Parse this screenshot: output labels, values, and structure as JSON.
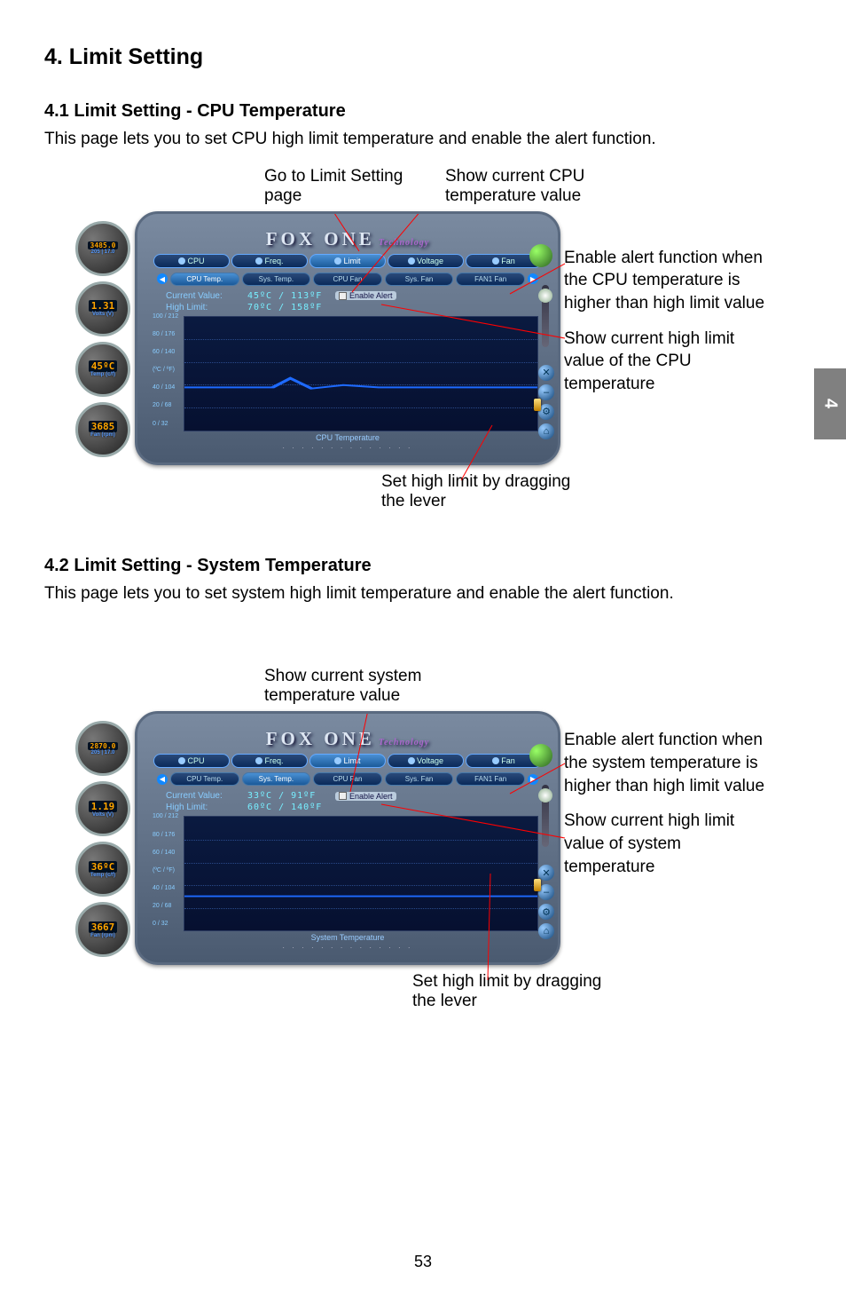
{
  "page_tab": "4",
  "page_number": "53",
  "heading": "4. Limit Setting",
  "section1": {
    "title": "4.1 Limit Setting - CPU Temperature",
    "desc": "This page lets you to set CPU high limit temperature and enable the alert function.",
    "callout_go_to_limit": "Go to Limit Setting page",
    "callout_show_current_cpu": "Show current CPU temperature value",
    "callout_enable_alert": "Enable alert function when the CPU temperature is higher than high limit value",
    "callout_show_high_limit": "Show current high limit value of the CPU temperature",
    "callout_set_high_limit": "Set high limit by dragging the lever",
    "app": {
      "brand": "FOX ONE",
      "brand_sub": "Technology",
      "tabs": [
        "CPU",
        "Freq.",
        "Limit",
        "Voltage",
        "Fan"
      ],
      "subtabs": [
        "CPU Temp.",
        "Sys. Temp.",
        "CPU Fan",
        "Sys. Fan",
        "FAN1 Fan"
      ],
      "active_tab": 2,
      "active_subtab": 0,
      "current_label": "Current Value:",
      "current_value": "45ºC / 113ºF",
      "high_label": "High Limit:",
      "high_value": "70ºC / 158ºF",
      "enable_label": "Enable Alert",
      "axis_unit": "(ºC / ºF)",
      "y_ticks": [
        "100 / 212",
        "80 / 176",
        "60 / 140",
        "40 / 104",
        "20 / 68",
        "0 / 32"
      ],
      "graph_title": "CPU Temperature",
      "gauges": {
        "freq_main": "3485.0",
        "freq_sub": "205 | 17.0",
        "voltage": "1.31",
        "voltage_sub": "Volts (V)",
        "temp": "45ºC",
        "temp_sub": "Temp (c/f)",
        "fan": "3685",
        "fan_sub": "Fan (rpm)"
      }
    }
  },
  "section2": {
    "title": "4.2 Limit Setting - System Temperature",
    "desc": "This page lets you to set system high limit temperature and enable the alert function.",
    "callout_show_current_sys": "Show current system temperature value",
    "callout_enable_alert": "Enable alert function when the system temperature is higher than high limit value",
    "callout_show_high_limit": "Show current high limit value of system temperature",
    "callout_set_high_limit": "Set high limit by dragging the lever",
    "app": {
      "brand": "FOX ONE",
      "brand_sub": "Technology",
      "tabs": [
        "CPU",
        "Freq.",
        "Limit",
        "Voltage",
        "Fan"
      ],
      "subtabs": [
        "CPU Temp.",
        "Sys. Temp.",
        "CPU Fan",
        "Sys. Fan",
        "FAN1 Fan"
      ],
      "active_tab": 2,
      "active_subtab": 1,
      "current_label": "Current Value:",
      "current_value": "33ºC / 91ºF",
      "high_label": "High Limit:",
      "high_value": "60ºC / 140ºF",
      "enable_label": "Enable Alert",
      "axis_unit": "(ºC / ºF)",
      "y_ticks": [
        "100 / 212",
        "80 / 176",
        "60 / 140",
        "40 / 104",
        "20 / 68",
        "0 / 32"
      ],
      "graph_title": "System Temperature",
      "gauges": {
        "freq_main": "2870.0",
        "freq_sub": "205 | 17.0",
        "voltage": "1.19",
        "voltage_sub": "Volts (V)",
        "temp": "36ºC",
        "temp_sub": "Temp (c/f)",
        "fan": "3667",
        "fan_sub": "Fan (rpm)"
      }
    }
  }
}
